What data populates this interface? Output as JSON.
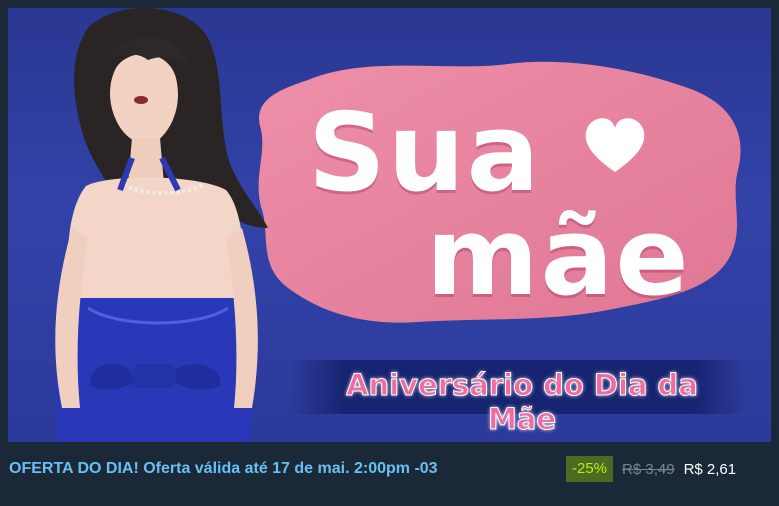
{
  "capsule": {
    "title_line1": "Sua",
    "title_line2": "mãe",
    "subtitle": "Aniversário do Dia da Mãe",
    "heart_icon": "heart-icon"
  },
  "deal": {
    "offer_text": "OFERTA DO DIA! Oferta válida até 17 de mai. 2:00pm -03",
    "discount": "-25%",
    "original_price": "R$ 3,49",
    "final_price": "R$ 2,61"
  },
  "colors": {
    "page_bg": "#1b2838",
    "capsule_bg": "#2f3fa3",
    "blob_pink": "#e9839f",
    "offer_text": "#66c0f4",
    "discount_bg": "#4c6b22",
    "discount_text": "#beee11"
  }
}
